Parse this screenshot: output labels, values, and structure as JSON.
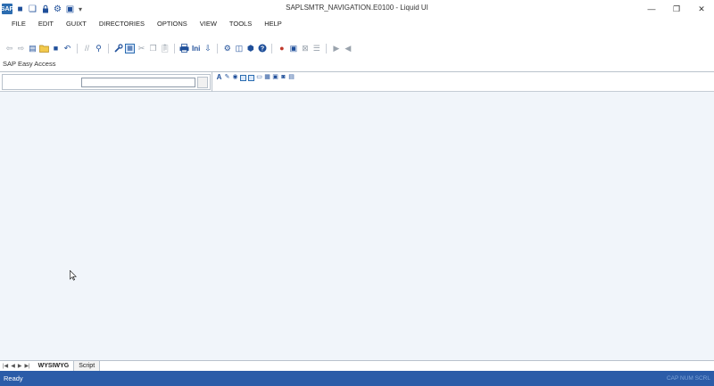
{
  "window": {
    "title": "SAPLSMTR_NAVIGATION.E0100 - Liquid UI",
    "minimize_glyph": "—",
    "maximize_glyph": "❐",
    "close_glyph": "✕"
  },
  "quick_access": {
    "icons": [
      "app-logo-icon",
      "save-icon",
      "copy-icon",
      "lock-icon",
      "gear-icon",
      "screen-icon",
      "dropdown-arrow-icon"
    ],
    "glyphs": [
      "SAP",
      "■",
      "❏",
      "🔒",
      "⚙",
      "▣",
      "▾"
    ]
  },
  "menu": {
    "items": [
      "FILE",
      "EDIT",
      "GUIXT",
      "DIRECTORIES",
      "OPTIONS",
      "VIEW",
      "TOOLS",
      "HELP"
    ]
  },
  "toolbar": {
    "ini_label": "Ini"
  },
  "screen": {
    "title": "SAP Easy Access"
  },
  "editor": {
    "command_value": ""
  },
  "tabs": {
    "items": [
      "WYSIWYG",
      "Script"
    ]
  },
  "status": {
    "text": "Ready",
    "keys": "CAP  NUM  SCRL"
  },
  "colors": {
    "status_bar": "#2b5ca8",
    "accent": "#1f4f9a",
    "canvas": "#f1f5fa"
  }
}
